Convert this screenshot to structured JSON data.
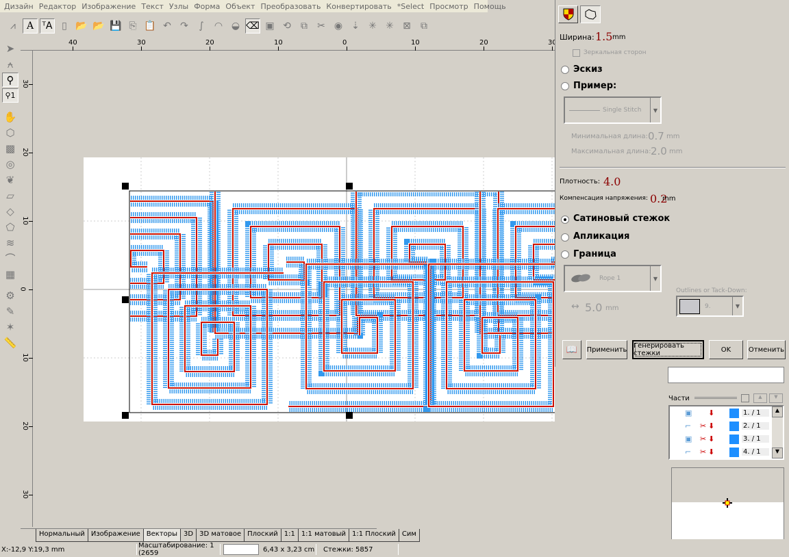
{
  "menu": [
    "Дизайн",
    "Редактор",
    "Изображение",
    "Текст",
    "Узлы",
    "Форма",
    "Объект",
    "Преобразовать",
    "Конвертировать",
    "*Select",
    "Просмотр",
    "Помощь"
  ],
  "toolbar_icons": [
    "stitch-icon",
    "text-a-icon",
    "text-edit-icon",
    "new-file-icon",
    "open-icon",
    "open-folder-icon",
    "save-icon",
    "copy-icon",
    "paste-icon",
    "undo-icon",
    "redo-icon",
    "bezier-icon",
    "gauge-icon",
    "fill-icon",
    "eraser-icon",
    "window-icon",
    "rotate-icon",
    "frame-icon",
    "eye-cut-icon",
    "eye-icon",
    "walk-icon",
    "tree-icon",
    "tree2-icon",
    "stitch-grid-icon",
    "layers-icon"
  ],
  "left_tools": [
    "arrow-icon",
    "node-icon",
    "zoom-icon",
    "zoom-1-icon",
    "hand-icon",
    "shape-icon",
    "fill-stitch-icon",
    "circle-icon",
    "leaf-icon",
    "rect-icon",
    "shape2-icon",
    "polygon-icon",
    "zigzag-icon",
    "curve-icon",
    "grid-icon",
    "gear-icon",
    "pen-icon",
    "magic-icon",
    "ruler-icon"
  ],
  "ruler": {
    "h_labels": [
      "40",
      "30",
      "20",
      "10",
      "0",
      "10",
      "20",
      "30"
    ],
    "v_labels": [
      "30",
      "20",
      "10",
      "0",
      "10",
      "20",
      "30"
    ]
  },
  "panel": {
    "width_label": "Ширина:",
    "width_value": "1.5",
    "width_unit": "mm",
    "mirror_label": "Зеркальная сторон",
    "mirror_checked": false,
    "sketch_label": "Эскиз",
    "example_label": "Пример:",
    "stitch_combo": "Single Stitch",
    "min_len_label": "Минимальная длина:",
    "min_len_value": "0.7",
    "min_len_unit": "mm",
    "max_len_label": "Максимальная длина:",
    "max_len_value": "2.0",
    "max_len_unit": "mm",
    "density_label": "Плотность:",
    "density_value": "4.0",
    "comp_label": "Компенсация напряжения:",
    "comp_value": "0.2",
    "comp_unit": "mm",
    "satin_label": "Сатиновый стежок",
    "applique_label": "Апликация",
    "border_label": "Граница",
    "selected_mode": "satin",
    "rope_combo": "Rope 1",
    "spacing_value": "5.0",
    "spacing_unit": "mm",
    "outlines_label": "Outlines or Tack-Down:",
    "outlines_value": "9.",
    "apply": "Применить",
    "generate": "Генерировать стежки",
    "ok": "OK",
    "cancel": "Отменить"
  },
  "parts": {
    "label": "Части",
    "items": [
      {
        "label": "1. / 1"
      },
      {
        "label": "2. / 1"
      },
      {
        "label": "3. / 1"
      },
      {
        "label": "4. / 1"
      }
    ],
    "color": "#1e8fff"
  },
  "tabs": [
    "Нормальный",
    "Изображение",
    "Векторы",
    "3D",
    "3D матовое",
    "Плоский",
    "1:1",
    "1:1 матовый",
    "1:1 Плоский",
    "Сим"
  ],
  "active_tab": "Векторы",
  "status": {
    "coords": "X:-12,9   Y:19,3 mm",
    "scale": "Масштабирование: 1 (2659",
    "size": "6,43 x 3,23 cm",
    "stitches": "Стежки: 5857"
  },
  "colors": {
    "stitch_blue": "#3399ee",
    "path_red": "#cc1100",
    "value_red": "#8b0000"
  }
}
